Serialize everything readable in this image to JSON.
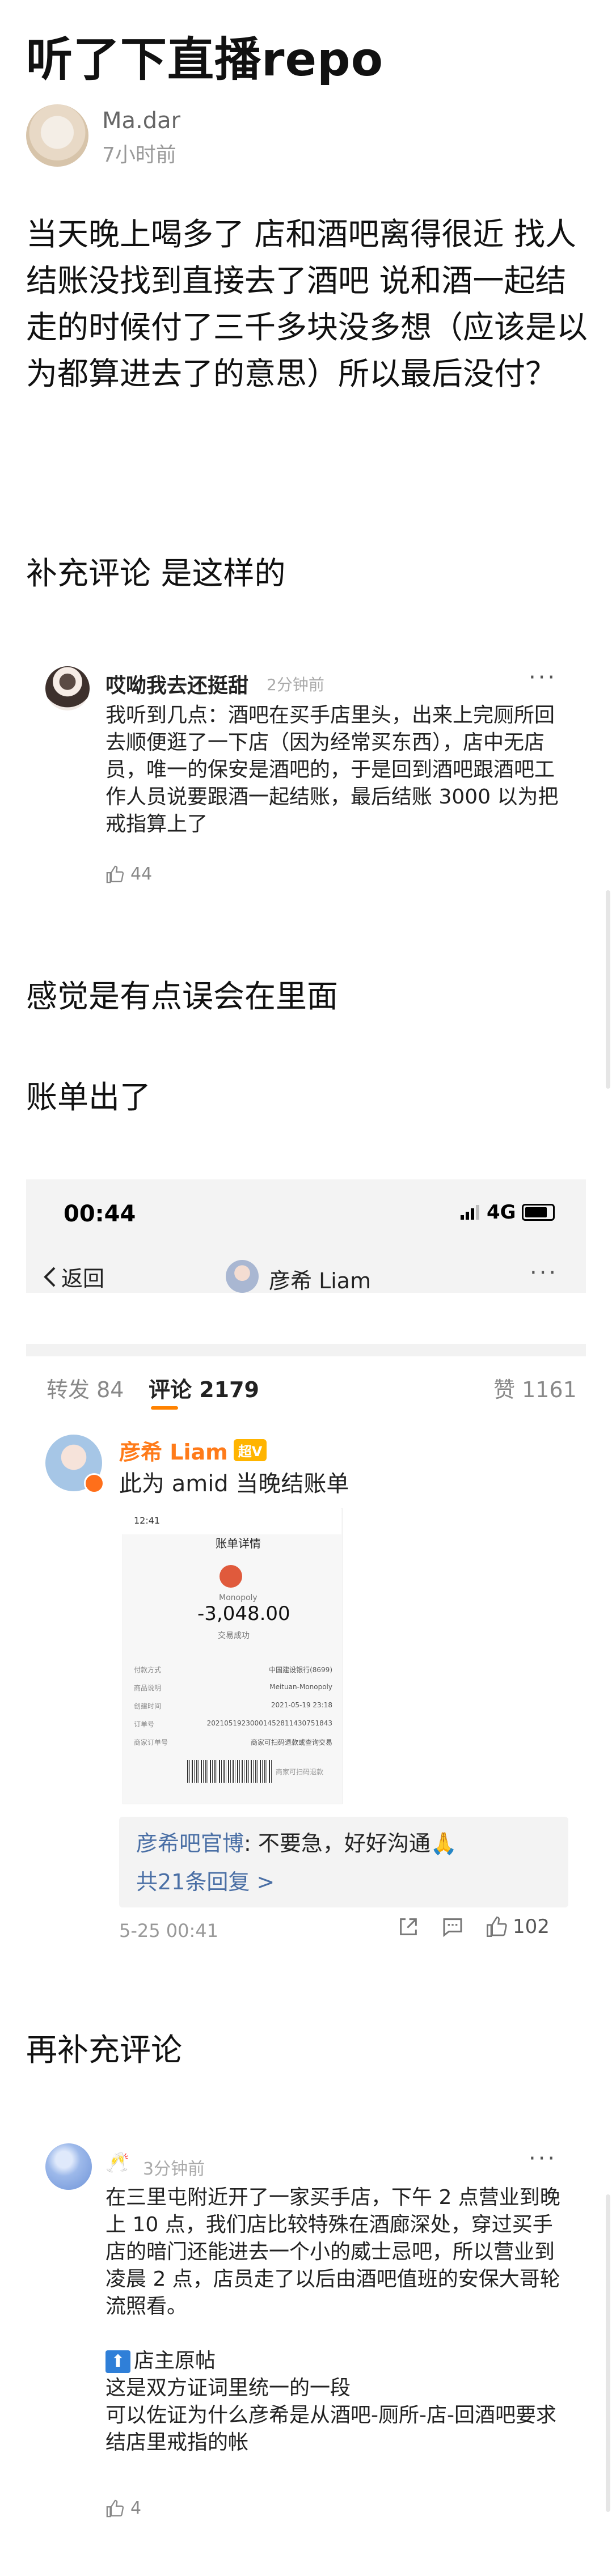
{
  "post": {
    "title": "听了下直播repo",
    "author": "Ma.dar",
    "time": "7小时前",
    "para1": "当天晚上喝多了 店和酒吧离得很近 找人结账没找到直接去了酒吧 说和酒一起结 走的时候付了三千多块没多想（应该是以为都算进去了的意思）所以最后没付？",
    "para2": "补充评论 是这样的",
    "para3": "感觉是有点误会在里面",
    "para4": "账单出了",
    "para5": "再补充评论"
  },
  "quote1": {
    "name": "哎呦我去还挺甜",
    "time": "2分钟前",
    "text": "我听到几点：酒吧在买手店里头，出来上完厕所回去顺便逛了一下店（因为经常买东西），店中无店员，唯一的保安是酒吧的，于是回到酒吧跟酒吧工作人员说要跟酒一起结账，最后结账 3000 以为把戒指算上了",
    "likes": "44",
    "more": "···"
  },
  "screenshot": {
    "status_time": "00:44",
    "network": "4G",
    "back": "返回",
    "nav_name": "彦希 Liam",
    "nav_more": "···",
    "tab_repost": "转发 84",
    "tab_comment": "评论 2179",
    "tab_like": "赞 1161",
    "commenter": "彦希 Liam",
    "vip": "超V",
    "comment_text": "此为 amid 当晚结账单",
    "receipt": {
      "header_time": "12:41",
      "title": "账单详情",
      "merchant": "Monopoly",
      "amount": "-3,048.00",
      "status": "交易成功",
      "rows": [
        {
          "k": "付款方式",
          "v": "中国建设银行(8699)"
        },
        {
          "k": "商品说明",
          "v": "Meituan-Monopoly"
        },
        {
          "k": "创建时间",
          "v": "2021-05-19 23:18"
        },
        {
          "k": "订单号",
          "v": "20210519230001452811430751843"
        },
        {
          "k": "商家订单号",
          "v": "商家可扫码退款或查询交易"
        }
      ],
      "barcode_label": "商家可扫码退款"
    },
    "reply_author": "彦希吧官博",
    "reply_text": ": 不要急，好好沟通🙏",
    "reply_count": "共21条回复 >",
    "comment_time": "5-25 00:41",
    "like_count": "102"
  },
  "quote2": {
    "cheers": "🥂",
    "time": "3分钟前",
    "more": "···",
    "text1": "在三里屯附近开了一家买手店，下午 2 点营业到晚上 10 点，我们店比较特殊在酒廊深处，穿过买手店的暗门还能进去一个小的威士忌吧，所以营业到凌晨 2 点，店员走了以后由酒吧值班的安保大哥轮流照看。",
    "up_label": "店主原帖",
    "text2": "这是双方证词里统一的一段\n可以佐证为什么彦希是从酒吧-厕所-店-回酒吧要求结店里戒指的帐",
    "likes": "4"
  }
}
